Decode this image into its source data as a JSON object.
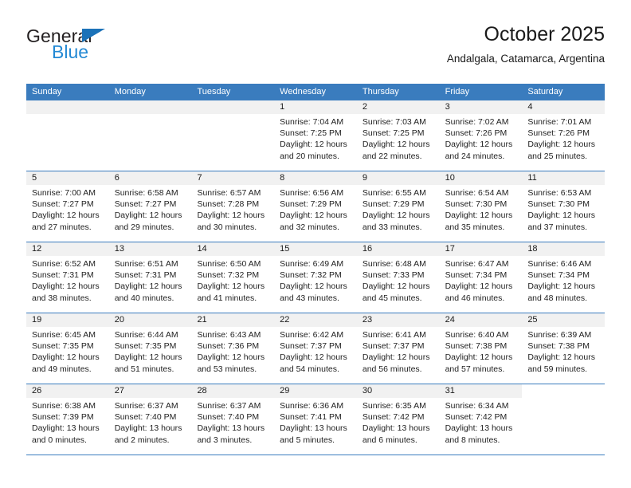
{
  "brand": {
    "name_part1": "General",
    "name_part2": "Blue",
    "triangle_color": "#1b72b8",
    "blue_color": "#2389d4"
  },
  "header": {
    "title": "October 2025",
    "subtitle": "Andalgala, Catamarca, Argentina"
  },
  "theme": {
    "header_row_bg": "#3a7cbe",
    "daynum_bar_bg": "#f1f1f1",
    "grid_line": "#3a7cbe",
    "text": "#1a1a1a"
  },
  "weekdays": [
    "Sunday",
    "Monday",
    "Tuesday",
    "Wednesday",
    "Thursday",
    "Friday",
    "Saturday"
  ],
  "weeks": [
    [
      {
        "day": "",
        "sunrise": "",
        "sunset": "",
        "daylight1": "",
        "daylight2": "",
        "state": "empty"
      },
      {
        "day": "",
        "sunrise": "",
        "sunset": "",
        "daylight1": "",
        "daylight2": "",
        "state": "empty"
      },
      {
        "day": "",
        "sunrise": "",
        "sunset": "",
        "daylight1": "",
        "daylight2": "",
        "state": "empty"
      },
      {
        "day": "1",
        "sunrise": "Sunrise: 7:04 AM",
        "sunset": "Sunset: 7:25 PM",
        "daylight1": "Daylight: 12 hours",
        "daylight2": "and 20 minutes.",
        "state": "filled"
      },
      {
        "day": "2",
        "sunrise": "Sunrise: 7:03 AM",
        "sunset": "Sunset: 7:25 PM",
        "daylight1": "Daylight: 12 hours",
        "daylight2": "and 22 minutes.",
        "state": "filled"
      },
      {
        "day": "3",
        "sunrise": "Sunrise: 7:02 AM",
        "sunset": "Sunset: 7:26 PM",
        "daylight1": "Daylight: 12 hours",
        "daylight2": "and 24 minutes.",
        "state": "filled"
      },
      {
        "day": "4",
        "sunrise": "Sunrise: 7:01 AM",
        "sunset": "Sunset: 7:26 PM",
        "daylight1": "Daylight: 12 hours",
        "daylight2": "and 25 minutes.",
        "state": "filled"
      }
    ],
    [
      {
        "day": "5",
        "sunrise": "Sunrise: 7:00 AM",
        "sunset": "Sunset: 7:27 PM",
        "daylight1": "Daylight: 12 hours",
        "daylight2": "and 27 minutes.",
        "state": "filled"
      },
      {
        "day": "6",
        "sunrise": "Sunrise: 6:58 AM",
        "sunset": "Sunset: 7:27 PM",
        "daylight1": "Daylight: 12 hours",
        "daylight2": "and 29 minutes.",
        "state": "filled"
      },
      {
        "day": "7",
        "sunrise": "Sunrise: 6:57 AM",
        "sunset": "Sunset: 7:28 PM",
        "daylight1": "Daylight: 12 hours",
        "daylight2": "and 30 minutes.",
        "state": "filled"
      },
      {
        "day": "8",
        "sunrise": "Sunrise: 6:56 AM",
        "sunset": "Sunset: 7:29 PM",
        "daylight1": "Daylight: 12 hours",
        "daylight2": "and 32 minutes.",
        "state": "filled"
      },
      {
        "day": "9",
        "sunrise": "Sunrise: 6:55 AM",
        "sunset": "Sunset: 7:29 PM",
        "daylight1": "Daylight: 12 hours",
        "daylight2": "and 33 minutes.",
        "state": "filled"
      },
      {
        "day": "10",
        "sunrise": "Sunrise: 6:54 AM",
        "sunset": "Sunset: 7:30 PM",
        "daylight1": "Daylight: 12 hours",
        "daylight2": "and 35 minutes.",
        "state": "filled"
      },
      {
        "day": "11",
        "sunrise": "Sunrise: 6:53 AM",
        "sunset": "Sunset: 7:30 PM",
        "daylight1": "Daylight: 12 hours",
        "daylight2": "and 37 minutes.",
        "state": "filled"
      }
    ],
    [
      {
        "day": "12",
        "sunrise": "Sunrise: 6:52 AM",
        "sunset": "Sunset: 7:31 PM",
        "daylight1": "Daylight: 12 hours",
        "daylight2": "and 38 minutes.",
        "state": "filled"
      },
      {
        "day": "13",
        "sunrise": "Sunrise: 6:51 AM",
        "sunset": "Sunset: 7:31 PM",
        "daylight1": "Daylight: 12 hours",
        "daylight2": "and 40 minutes.",
        "state": "filled"
      },
      {
        "day": "14",
        "sunrise": "Sunrise: 6:50 AM",
        "sunset": "Sunset: 7:32 PM",
        "daylight1": "Daylight: 12 hours",
        "daylight2": "and 41 minutes.",
        "state": "filled"
      },
      {
        "day": "15",
        "sunrise": "Sunrise: 6:49 AM",
        "sunset": "Sunset: 7:32 PM",
        "daylight1": "Daylight: 12 hours",
        "daylight2": "and 43 minutes.",
        "state": "filled"
      },
      {
        "day": "16",
        "sunrise": "Sunrise: 6:48 AM",
        "sunset": "Sunset: 7:33 PM",
        "daylight1": "Daylight: 12 hours",
        "daylight2": "and 45 minutes.",
        "state": "filled"
      },
      {
        "day": "17",
        "sunrise": "Sunrise: 6:47 AM",
        "sunset": "Sunset: 7:34 PM",
        "daylight1": "Daylight: 12 hours",
        "daylight2": "and 46 minutes.",
        "state": "filled"
      },
      {
        "day": "18",
        "sunrise": "Sunrise: 6:46 AM",
        "sunset": "Sunset: 7:34 PM",
        "daylight1": "Daylight: 12 hours",
        "daylight2": "and 48 minutes.",
        "state": "filled"
      }
    ],
    [
      {
        "day": "19",
        "sunrise": "Sunrise: 6:45 AM",
        "sunset": "Sunset: 7:35 PM",
        "daylight1": "Daylight: 12 hours",
        "daylight2": "and 49 minutes.",
        "state": "filled"
      },
      {
        "day": "20",
        "sunrise": "Sunrise: 6:44 AM",
        "sunset": "Sunset: 7:35 PM",
        "daylight1": "Daylight: 12 hours",
        "daylight2": "and 51 minutes.",
        "state": "filled"
      },
      {
        "day": "21",
        "sunrise": "Sunrise: 6:43 AM",
        "sunset": "Sunset: 7:36 PM",
        "daylight1": "Daylight: 12 hours",
        "daylight2": "and 53 minutes.",
        "state": "filled"
      },
      {
        "day": "22",
        "sunrise": "Sunrise: 6:42 AM",
        "sunset": "Sunset: 7:37 PM",
        "daylight1": "Daylight: 12 hours",
        "daylight2": "and 54 minutes.",
        "state": "filled"
      },
      {
        "day": "23",
        "sunrise": "Sunrise: 6:41 AM",
        "sunset": "Sunset: 7:37 PM",
        "daylight1": "Daylight: 12 hours",
        "daylight2": "and 56 minutes.",
        "state": "filled"
      },
      {
        "day": "24",
        "sunrise": "Sunrise: 6:40 AM",
        "sunset": "Sunset: 7:38 PM",
        "daylight1": "Daylight: 12 hours",
        "daylight2": "and 57 minutes.",
        "state": "filled"
      },
      {
        "day": "25",
        "sunrise": "Sunrise: 6:39 AM",
        "sunset": "Sunset: 7:38 PM",
        "daylight1": "Daylight: 12 hours",
        "daylight2": "and 59 minutes.",
        "state": "filled"
      }
    ],
    [
      {
        "day": "26",
        "sunrise": "Sunrise: 6:38 AM",
        "sunset": "Sunset: 7:39 PM",
        "daylight1": "Daylight: 13 hours",
        "daylight2": "and 0 minutes.",
        "state": "filled"
      },
      {
        "day": "27",
        "sunrise": "Sunrise: 6:37 AM",
        "sunset": "Sunset: 7:40 PM",
        "daylight1": "Daylight: 13 hours",
        "daylight2": "and 2 minutes.",
        "state": "filled"
      },
      {
        "day": "28",
        "sunrise": "Sunrise: 6:37 AM",
        "sunset": "Sunset: 7:40 PM",
        "daylight1": "Daylight: 13 hours",
        "daylight2": "and 3 minutes.",
        "state": "filled"
      },
      {
        "day": "29",
        "sunrise": "Sunrise: 6:36 AM",
        "sunset": "Sunset: 7:41 PM",
        "daylight1": "Daylight: 13 hours",
        "daylight2": "and 5 minutes.",
        "state": "filled"
      },
      {
        "day": "30",
        "sunrise": "Sunrise: 6:35 AM",
        "sunset": "Sunset: 7:42 PM",
        "daylight1": "Daylight: 13 hours",
        "daylight2": "and 6 minutes.",
        "state": "filled"
      },
      {
        "day": "31",
        "sunrise": "Sunrise: 6:34 AM",
        "sunset": "Sunset: 7:42 PM",
        "daylight1": "Daylight: 13 hours",
        "daylight2": "and 8 minutes.",
        "state": "filled"
      },
      {
        "day": "",
        "sunrise": "",
        "sunset": "",
        "daylight1": "",
        "daylight2": "",
        "state": "blank"
      }
    ]
  ]
}
